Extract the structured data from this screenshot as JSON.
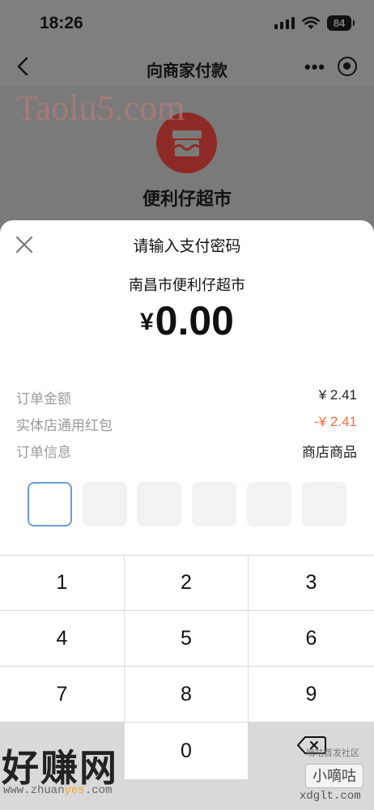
{
  "status_bar": {
    "time": "18:26",
    "battery": "84"
  },
  "nav": {
    "title": "向商家付款",
    "more": "•••"
  },
  "merchant": {
    "name": "便利仔超市"
  },
  "sheet": {
    "title": "请输入支付密码",
    "payee": "南昌市便利仔超市",
    "currency": "¥",
    "amount": "0.00",
    "rows": [
      {
        "label": "订单金额",
        "value": "¥ 2.41"
      },
      {
        "label": "实体店通用红包",
        "value": "-¥ 2.41"
      },
      {
        "label": "订单信息",
        "value": "商店商品"
      }
    ],
    "pin_length": 6
  },
  "keypad": {
    "keys": [
      "1",
      "2",
      "3",
      "4",
      "5",
      "6",
      "7",
      "8",
      "9",
      "0"
    ]
  },
  "watermarks": {
    "top": "Taolu5.com",
    "bottom_cn": "好赚网",
    "bottom_url_a": "www.zhuan",
    "bottom_url_b": "yes",
    "bottom_url_c": ".com",
    "right_label": "小嘀咕",
    "right_small": "嘀咕首发社区",
    "right_url": "xdglt.com"
  },
  "colors": {
    "accent_red": "#f26d3d",
    "pin_focus": "#6a9bd6",
    "logo_red": "#8e2a26"
  }
}
